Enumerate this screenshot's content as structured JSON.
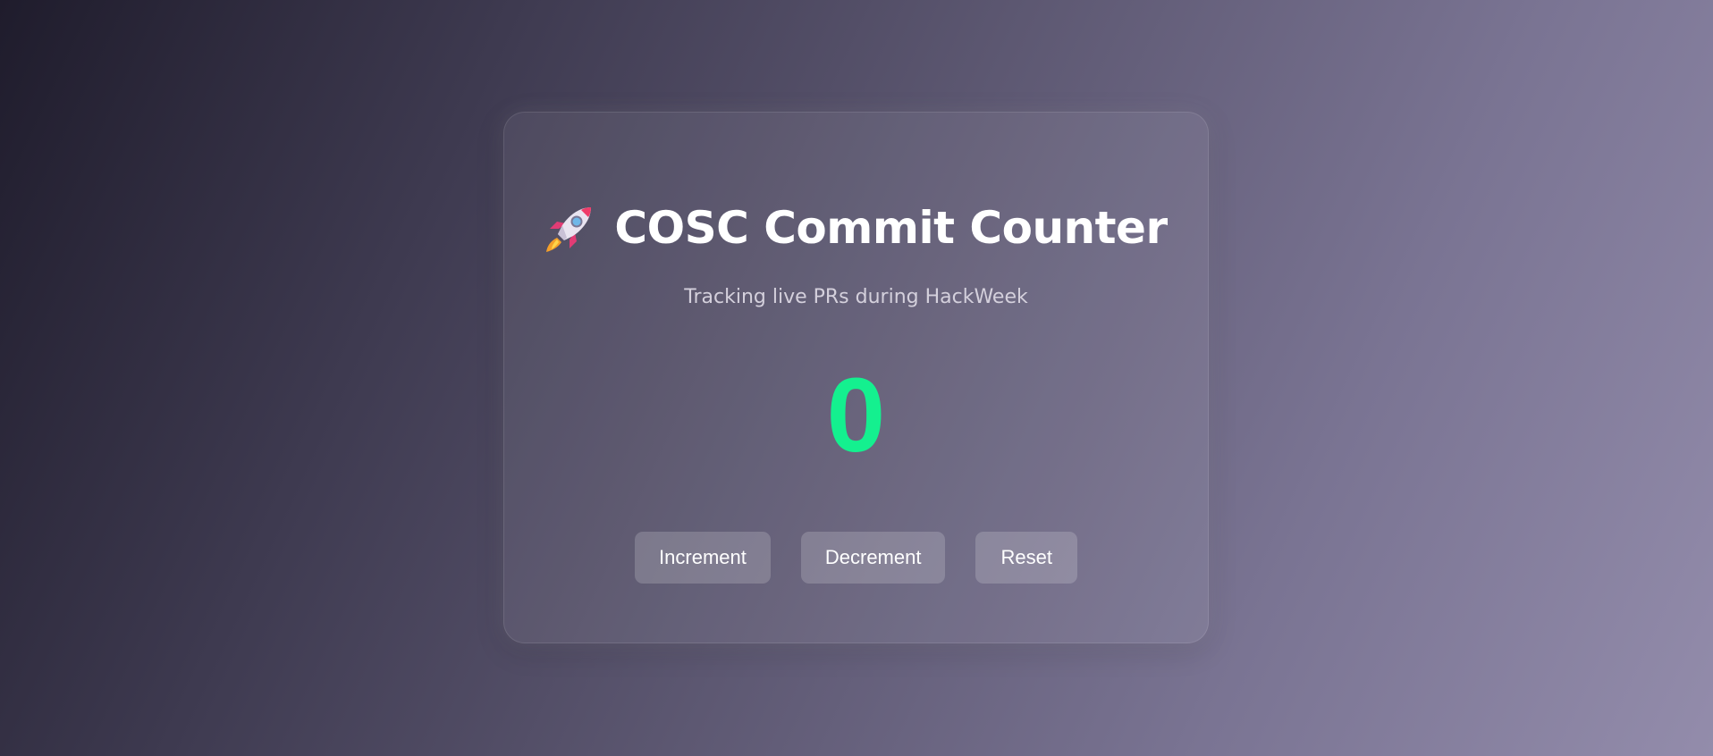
{
  "counter": {
    "title": "COSC Commit Counter",
    "title_icon": "rocket-icon",
    "subtitle": "Tracking live PRs during HackWeek",
    "value": "0",
    "value_color": "#14f08f"
  },
  "buttons": {
    "increment_label": "Increment",
    "decrement_label": "Decrement",
    "reset_label": "Reset"
  }
}
